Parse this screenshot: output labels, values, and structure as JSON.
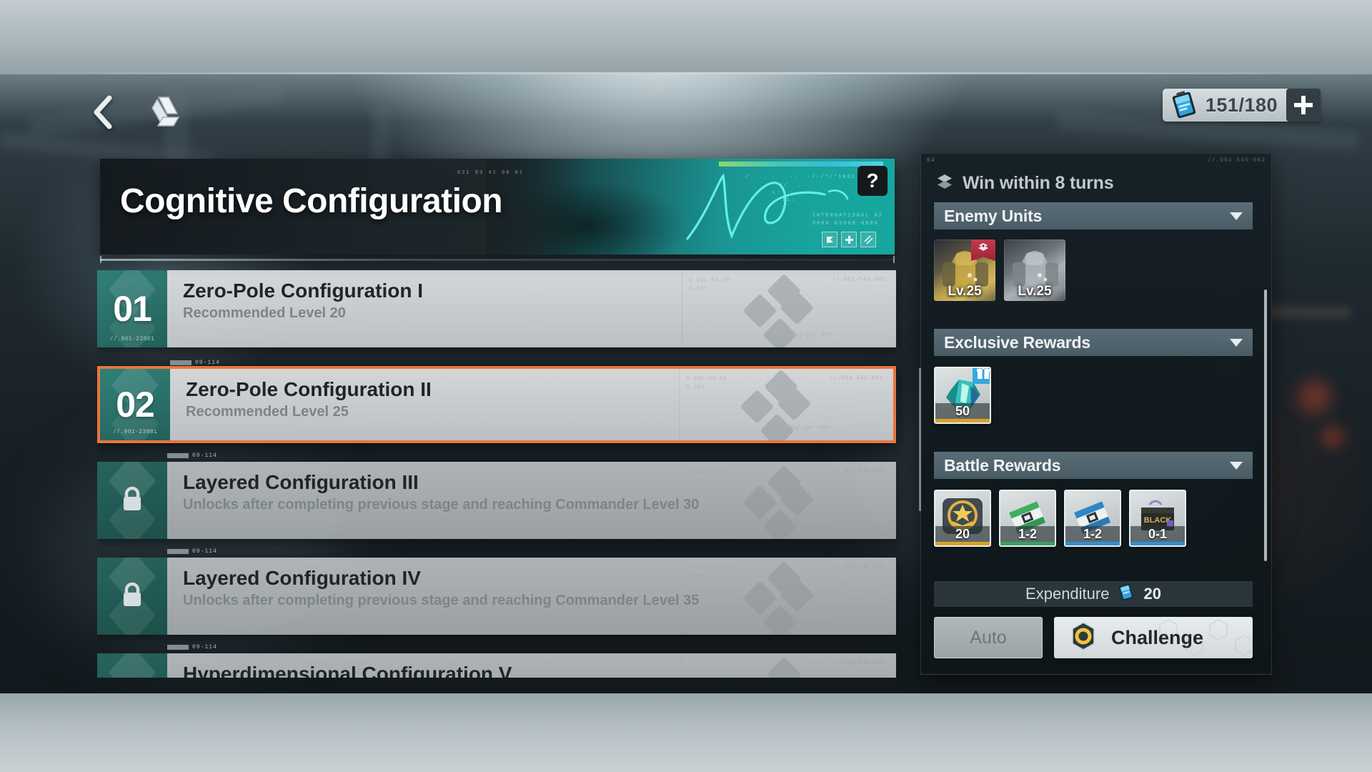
{
  "topbar": {
    "back_icon": "chevron-left-icon",
    "app_logo_icon": "drive-triangle-logo",
    "stamina": {
      "icon": "stamina-battery-icon",
      "value": "151/180",
      "add_label": "+"
    }
  },
  "banner": {
    "title": "Cognitive Configuration",
    "help_label": "?",
    "micro_code_top": "021  93  41  00  61",
    "micro_code_right": "71",
    "signature_caption": "INTERNATIONAL 02\n3000 03000 0006",
    "badges": [
      "badge-flag-icon",
      "badge-dpad-icon",
      "badge-stripe-icon"
    ]
  },
  "stages": [
    {
      "number": "01",
      "code": "//.901-23981",
      "name": "Zero-Pole Configuration I",
      "sub": "Recommended Level 20",
      "locked": false,
      "selected": false,
      "art_code_tr": "//.003-545-002",
      "art_code_tl": "0.03C 94.50\n0.107",
      "art_scribble": "j-; c0nf-ep~ one",
      "tag_text": "09-114"
    },
    {
      "number": "02",
      "code": "//.901-23981",
      "name": "Zero-Pole Configuration II",
      "sub": "Recommended Level 25",
      "locked": false,
      "selected": true,
      "art_code_tr": "//.003-545-002",
      "art_code_tl": "0.03C 94.50\n0.107",
      "art_scribble": "j-; c0nf-ep~ one",
      "tag_text": "09-114"
    },
    {
      "number": "",
      "code": "",
      "name": "Layered Configuration III",
      "sub": "Unlocks after completing previous stage and reaching Commander Level 30",
      "locked": true,
      "selected": false,
      "art_code_tr": "//.003-545-002",
      "art_code_tl": "0.03C 94.50\n0.107",
      "art_scribble": "j-; c0nf-ep~ one",
      "tag_text": "09-114"
    },
    {
      "number": "",
      "code": "",
      "name": "Layered Configuration IV",
      "sub": "Unlocks after completing previous stage and reaching Commander Level 35",
      "locked": true,
      "selected": false,
      "art_code_tr": "//.003-545-002",
      "art_code_tl": "0.03C 94.50\n0.107",
      "art_scribble": "j-; c0nf-ep~ one",
      "tag_text": "09-114"
    },
    {
      "number": "",
      "code": "",
      "name": "Hyperdimensional Configuration V",
      "sub": "",
      "locked": true,
      "selected": false,
      "art_code_tr": "//.003-545-002",
      "art_code_tl": "",
      "art_scribble": "",
      "tag_text": "09-114"
    }
  ],
  "panel": {
    "corner_code_left": "64",
    "corner_code_right": "//.003-565-002",
    "objective": {
      "icon": "layered-hex-icon",
      "text": "Win within 8 turns"
    },
    "enemy_section": {
      "label": "Enemy Units",
      "caret_icon": "chevron-down-icon",
      "units": [
        {
          "name": "enemy-unit-gold-mech",
          "level": "Lv.25",
          "faction_icon": "faction-crest-icon"
        },
        {
          "name": "enemy-unit-grey-mech",
          "level": "Lv.25",
          "faction_icon": ""
        }
      ]
    },
    "exclusive_section": {
      "label": "Exclusive Rewards",
      "caret_icon": "chevron-down-icon",
      "rewards": [
        {
          "name": "teal-crystal-item",
          "qty": "50",
          "bar_color": "#d8a326",
          "badge_icon": "gift-icon"
        }
      ]
    },
    "battle_section": {
      "label": "Battle Rewards",
      "caret_icon": "chevron-down-icon",
      "rewards": [
        {
          "name": "commander-exp-badge",
          "qty": "20",
          "bar_color": "#d8a326"
        },
        {
          "name": "green-data-chip",
          "qty": "1-2",
          "bar_color": "#35a35c"
        },
        {
          "name": "blue-data-chip",
          "qty": "1-2",
          "bar_color": "#2e90cf"
        },
        {
          "name": "supply-crate",
          "qty": "0-1",
          "bar_color": "#2e90cf"
        }
      ]
    },
    "expenditure": {
      "label": "Expenditure",
      "icon": "stamina-battery-icon",
      "value": "20"
    },
    "actions": {
      "auto_label": "Auto",
      "challenge_label": "Challenge",
      "challenge_icon": "hex-ring-icon"
    }
  },
  "colors": {
    "accent_selected": "#e8763c",
    "teal_badge": "#2a7169",
    "panel_bg": "#111a1f",
    "section_header": "#5d737e",
    "stamina_blue": "#35a8dd"
  }
}
